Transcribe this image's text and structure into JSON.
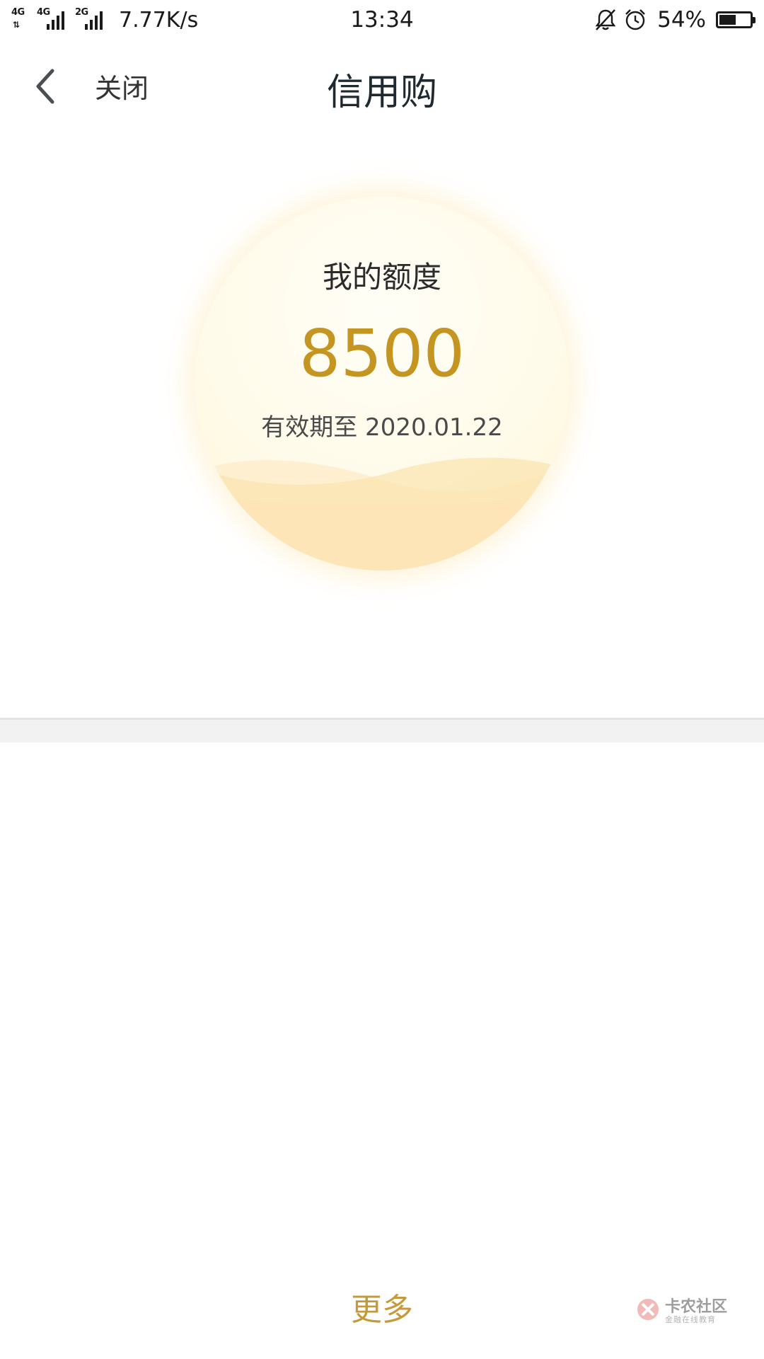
{
  "status_bar": {
    "signal_1": {
      "label": "4G",
      "arrows": "⇅"
    },
    "signal_2": {
      "label": "4G"
    },
    "signal_3": {
      "label": "2G"
    },
    "network_speed": "7.77K/s",
    "time": "13:34",
    "battery_percent": "54%",
    "battery_level": 0.54,
    "icons": [
      "signal-icon",
      "bell-off-icon",
      "alarm-clock-icon",
      "battery-icon"
    ]
  },
  "nav": {
    "close_label": "关闭",
    "title": "信用购",
    "back_icon": "chevron-left-icon"
  },
  "quota": {
    "label": "我的额度",
    "amount": "8500",
    "expiry": "有效期至 2020.01.22"
  },
  "footer": {
    "more_label": "更多"
  },
  "watermark": {
    "title": "卡农社区",
    "subtitle": "金融在线教育"
  },
  "colors": {
    "accent_gold": "#c49520",
    "more_gold": "#c49a3a",
    "title_text": "#1f2a30",
    "circle_bg": "#fffbea",
    "wave_fill": "#fde9bd",
    "divider_bg": "#f2f2f2"
  }
}
